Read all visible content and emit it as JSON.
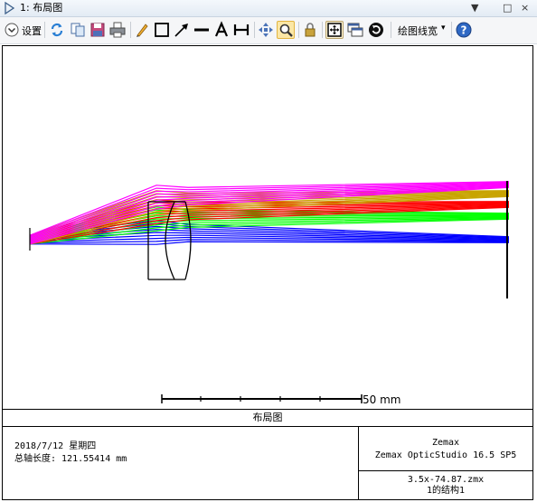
{
  "window": {
    "title": "1: 布局图",
    "pin_glyph": "▼",
    "maximize_glyph": "□",
    "close_glyph": "×"
  },
  "toolbar": {
    "settings_label": "设置",
    "line_width_label": "绘图线宽",
    "line_width_caret": "▾",
    "tools": [
      {
        "name": "settings-toggle-icon"
      },
      {
        "name": "refresh-icon"
      },
      {
        "name": "copy-icon"
      },
      {
        "name": "save-icon"
      },
      {
        "name": "print-icon"
      },
      {
        "name": "pencil-icon"
      },
      {
        "name": "rectangle-icon"
      },
      {
        "name": "arrow-icon"
      },
      {
        "name": "line-icon"
      },
      {
        "name": "text-icon"
      },
      {
        "name": "dimension-icon"
      },
      {
        "name": "pan-icon"
      },
      {
        "name": "zoom-icon",
        "active": true
      },
      {
        "name": "lock-icon"
      },
      {
        "name": "fit-window-icon"
      },
      {
        "name": "windows-icon"
      },
      {
        "name": "auto-update-icon"
      },
      {
        "name": "help-icon"
      }
    ]
  },
  "plot": {
    "scale_label": "50 mm",
    "ray_colors": [
      "#0000ff",
      "#00ff00",
      "#ff0000",
      "#c8a400",
      "#ff00ff"
    ]
  },
  "info": {
    "caption": "布局图",
    "date_line": "2018/7/12 星期四",
    "axis_length_line": "总轴长度:  121.55414 mm",
    "vendor": "Zemax",
    "product": "Zemax OpticStudio 16.5 SP5",
    "file_name": "3.5x-74.87.zmx",
    "configuration": "1的结构1"
  }
}
